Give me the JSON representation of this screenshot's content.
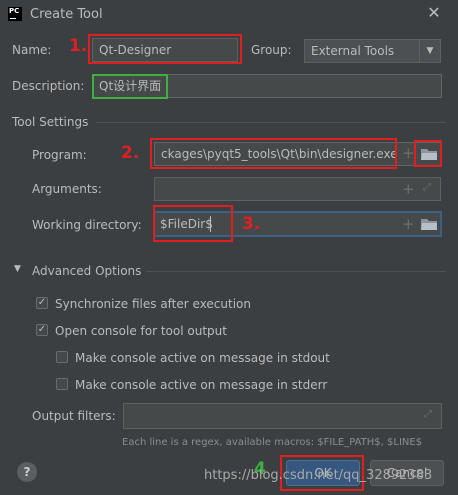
{
  "window": {
    "title": "Create Tool",
    "close_icon": "close-icon"
  },
  "form": {
    "name_label": "Name:",
    "name_value": "Qt-Designer",
    "group_label": "Group:",
    "group_value": "External Tools",
    "description_label": "Description:",
    "description_value": "Qt设计界面"
  },
  "tool_settings": {
    "heading": "Tool Settings",
    "program_label": "Program:",
    "program_value": "ckages\\pyqt5_tools\\Qt\\bin\\designer.exe",
    "arguments_label": "Arguments:",
    "arguments_value": "",
    "working_dir_label": "Working directory:",
    "working_dir_value": "$FileDir$"
  },
  "advanced": {
    "heading": "Advanced Options",
    "sync_label": "Synchronize files after execution",
    "sync_checked": true,
    "console_label": "Open console for tool output",
    "console_checked": true,
    "stdout_label": "Make console active on message in stdout",
    "stdout_checked": false,
    "stderr_label": "Make console active on message in stderr",
    "stderr_checked": false,
    "output_filters_label": "Output filters:",
    "output_filters_value": "",
    "hint": "Each line is a regex, available macros: $FILE_PATH$, $LINE$"
  },
  "footer": {
    "help": "?",
    "ok": "OK",
    "cancel": "Cancel"
  },
  "annotations": {
    "n1": "1.",
    "n2": "2.",
    "n3": "3.",
    "n4": "4"
  },
  "watermark": "https://blog.csdn.net/qq_32892383",
  "colors": {
    "background": "#3c3f41",
    "field": "#45494a",
    "annotation_red": "#e02020",
    "annotation_green": "#3cb043",
    "focus_blue": "#3d6185",
    "ok_button": "#365880"
  }
}
